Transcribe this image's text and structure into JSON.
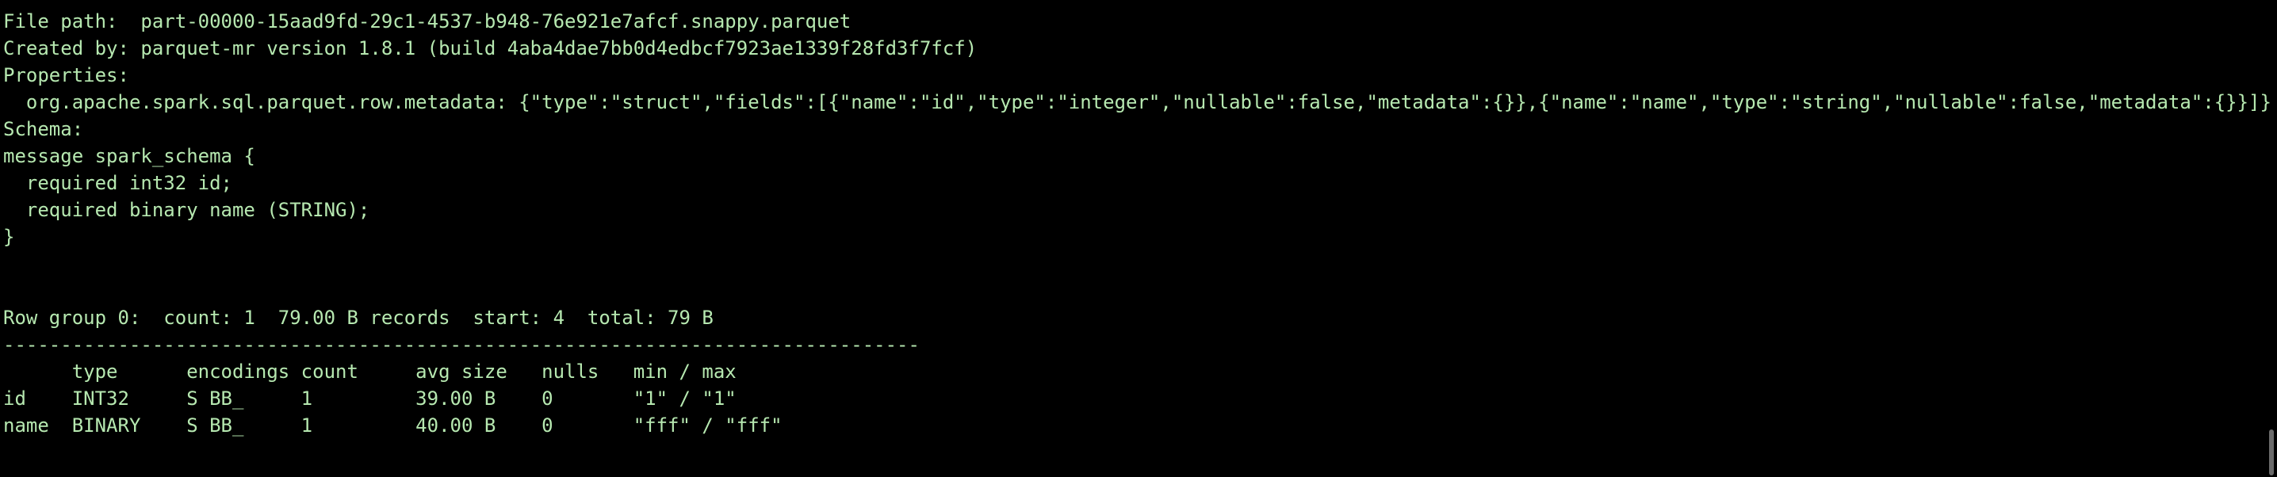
{
  "theme": {
    "background": "#000000",
    "text_color": "#b6e8b0"
  },
  "terminal": {
    "lines": [
      "",
      "File path:  part-00000-15aad9fd-29c1-4537-b948-76e921e7afcf.snappy.parquet",
      "Created by: parquet-mr version 1.8.1 (build 4aba4dae7bb0d4edbcf7923ae1339f28fd3f7fcf)",
      "Properties:",
      "  org.apache.spark.sql.parquet.row.metadata: {\"type\":\"struct\",\"fields\":[{\"name\":\"id\",\"type\":\"integer\",\"nullable\":false,\"metadata\":{}},{\"name\":\"name\",\"type\":\"string\",\"nullable\":false,\"metadata\":{}}]}",
      "Schema:",
      "message spark_schema {",
      "  required int32 id;",
      "  required binary name (STRING);",
      "}",
      "",
      "",
      "Row group 0:  count: 1  79.00 B records  start: 4  total: 79 B",
      "--------------------------------------------------------------------------------",
      "      type      encodings count     avg size   nulls   min / max",
      "id    INT32     S BB_     1         39.00 B    0       \"1\" / \"1\"",
      "name  BINARY    S BB_     1         40.00 B    0       \"fff\" / \"fff\""
    ]
  }
}
